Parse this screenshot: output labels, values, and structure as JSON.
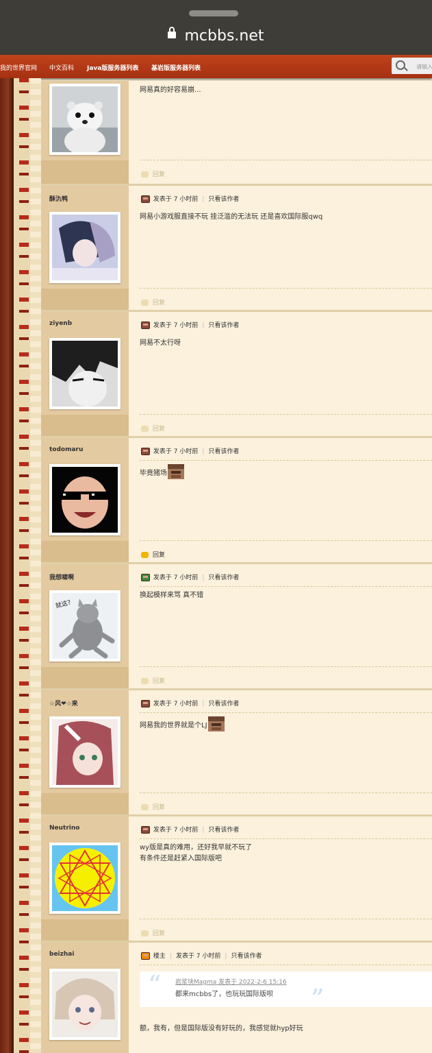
{
  "browser": {
    "url": "mcbbs.net"
  },
  "nav": {
    "items": [
      "我的世界官网",
      "中文百科",
      "Java版服务器列表",
      "基岩版服务器列表"
    ],
    "search_placeholder": "请输入"
  },
  "common": {
    "posted": "发表于 7 小时前",
    "only_author": "只看该作者",
    "reply": "回复",
    "op_badge": "楼主"
  },
  "posts": [
    {
      "username": "",
      "body": "网易真的好容易崩...",
      "avatar": "white-weasel-avatar"
    },
    {
      "username": "酥氿鸭",
      "body": "网易小游戏服直接不玩 挂泛滥的无法玩 还是喜欢国际服qwq",
      "avatar": "anime-boy-avatar"
    },
    {
      "username": "ziyenb",
      "body": "网易不太行呀",
      "avatar": "anime-grayscale-avatar"
    },
    {
      "username": "todomaru",
      "body": "毕竟猪场",
      "avatar": "baby-sunglasses-avatar"
    },
    {
      "username": "我想啸啊",
      "body": "换起模样来骂 真不错",
      "avatar": "cat-avatar",
      "avatar_text": "就这?"
    },
    {
      "username": "☆风❤☆来",
      "body": "网易我的世界就是个LJ",
      "avatar": "anime-girl-avatar"
    },
    {
      "username": "Neutrino",
      "body": "wy版是真的难用，还好我早就不玩了",
      "body2": "有条件还是赶紧入国际版吧",
      "avatar": "hexagram-avatar"
    },
    {
      "username": "beizhai",
      "body": "额，我有，但是国际版没有好玩的，我感觉就hyp好玩",
      "avatar": "anime-whitehair-avatar",
      "quote": {
        "header": "岩浆块Magma 发表于 2022-2-6 15:16",
        "text": "都来mcbbs了，也玩玩国际版呗"
      }
    }
  ]
}
